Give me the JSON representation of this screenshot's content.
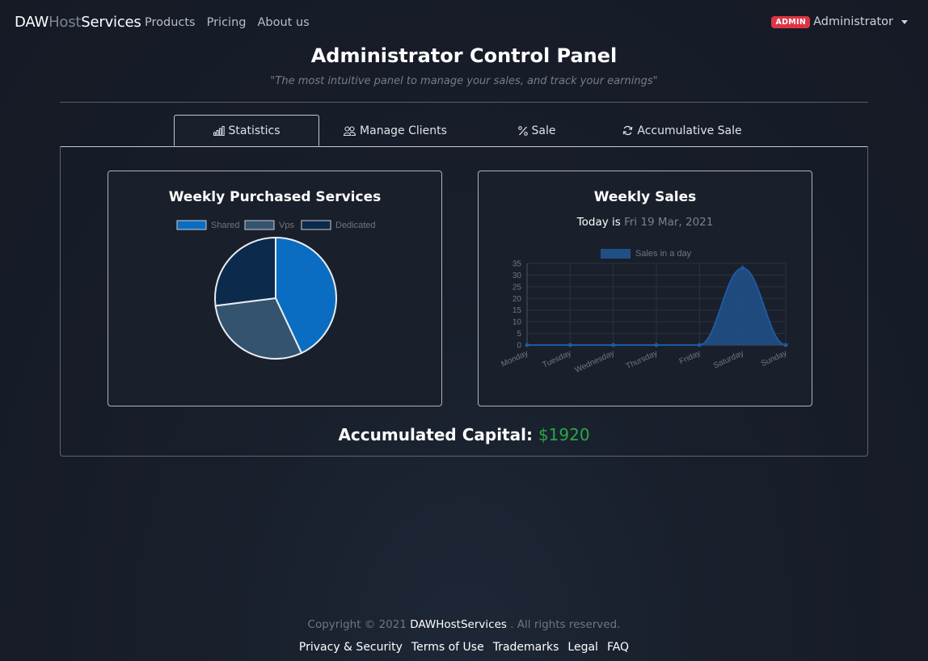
{
  "navbar": {
    "brand_part1": "DAW",
    "brand_part2": "Host",
    "brand_part3": "Services",
    "links": [
      "Products",
      "Pricing",
      "About us"
    ],
    "badge": "ADMIN",
    "user": "Administrator"
  },
  "header": {
    "title": "Administrator Control Panel",
    "subtitle": "\"The most intuitive panel to manage your sales, and track your earnings\""
  },
  "tabs": [
    {
      "label": "Statistics",
      "icon": "bar-chart-icon",
      "active": true
    },
    {
      "label": "Manage Clients",
      "icon": "people-icon",
      "active": false
    },
    {
      "label": "Sale",
      "icon": "percent-icon",
      "active": false
    },
    {
      "label": "Accumulative Sale",
      "icon": "refresh-icon",
      "active": false
    }
  ],
  "pie_card": {
    "title": "Weekly Purchased Services"
  },
  "line_card": {
    "title": "Weekly Sales",
    "today_label": "Today is",
    "today_date": "Fri 19 Mar, 2021"
  },
  "capital": {
    "label": "Accumulated Capital:",
    "amount": "$1920"
  },
  "footer": {
    "copyright_prefix": "Copyright © 2021",
    "copyright_brand": "DAWHostServices",
    "copyright_suffix": ". All rights reserved.",
    "links": [
      "Privacy & Security",
      "Terms of Use",
      "Trademarks",
      "Legal",
      "FAQ"
    ]
  },
  "colors": {
    "shared": "#0d6efd",
    "vps": "#35536e",
    "dedicated": "#0b2a4a",
    "sales_fill": "#1f4f86",
    "badge": "#dc3545",
    "capital": "#28a745"
  },
  "chart_data": [
    {
      "type": "pie",
      "labels": [
        "Shared",
        "Vps",
        "Dedicated"
      ],
      "values": [
        43,
        30,
        27
      ],
      "colors": [
        "#0a6dc2",
        "#34536f",
        "#0c2a4b"
      ],
      "legend": "top"
    },
    {
      "type": "area",
      "categories": [
        "Monday",
        "Tuesday",
        "Wednesday",
        "Thursday",
        "Friday",
        "Saturday",
        "Sunday"
      ],
      "series": [
        {
          "name": "Sales in a day",
          "values": [
            0,
            0,
            0,
            0,
            0,
            33,
            0
          ]
        }
      ],
      "ylim": [
        0,
        35
      ],
      "yticks": [
        0,
        5,
        10,
        15,
        20,
        25,
        30,
        35
      ],
      "grid": true,
      "legend": "top"
    }
  ]
}
